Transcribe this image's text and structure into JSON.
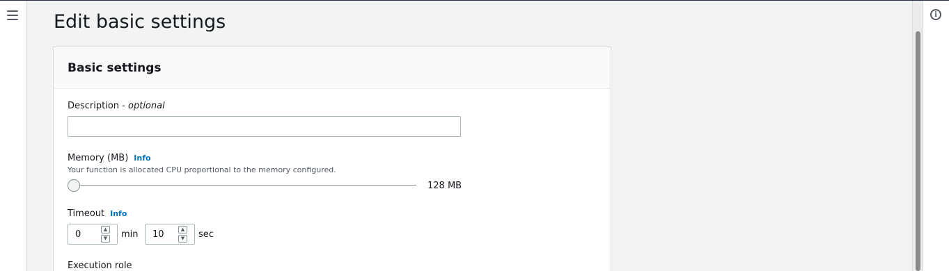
{
  "page": {
    "title": "Edit basic settings"
  },
  "nav": {
    "menu_icon": "hamburger-menu-icon",
    "info_icon": "info-circle-icon",
    "info_glyph": "i"
  },
  "panel": {
    "title": "Basic settings",
    "description": {
      "label": "Description",
      "optional": "optional",
      "separator": " - ",
      "value": "",
      "placeholder": ""
    },
    "memory": {
      "label": "Memory (MB)",
      "info": "Info",
      "helper": "Your function is allocated CPU proportional to the memory configured.",
      "value_display": "128 MB",
      "slider_fraction": 0
    },
    "timeout": {
      "label": "Timeout",
      "info": "Info",
      "min_value": "0",
      "min_unit": "min",
      "sec_value": "10",
      "sec_unit": "sec",
      "up_glyph": "▲",
      "down_glyph": "▼"
    },
    "execution_role": {
      "label": "Execution role"
    }
  },
  "colors": {
    "link": "#0073bb",
    "text": "#16191f",
    "background": "#f2f3f3"
  }
}
